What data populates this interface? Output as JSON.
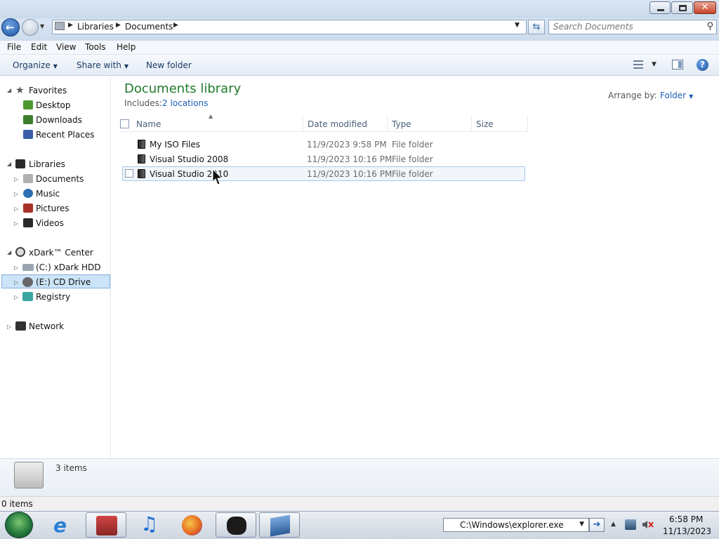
{
  "window": {
    "close_glyph": "✕"
  },
  "address": {
    "crumbs": [
      "Libraries",
      "Documents"
    ],
    "search_placeholder": "Search Documents"
  },
  "menu": [
    "File",
    "Edit",
    "View",
    "Tools",
    "Help"
  ],
  "commands": {
    "organize": "Organize",
    "share_with": "Share with",
    "new_folder": "New folder"
  },
  "nav": {
    "favorites": {
      "label": "Favorites",
      "items": [
        "Desktop",
        "Downloads",
        "Recent Places"
      ]
    },
    "libraries": {
      "label": "Libraries",
      "items": [
        "Documents",
        "Music",
        "Pictures",
        "Videos"
      ]
    },
    "computer": {
      "label": "xDark™ Center",
      "items": [
        "(C:) xDark HDD",
        "(E:) CD Drive",
        "Registry"
      ]
    },
    "network": {
      "label": "Network"
    }
  },
  "library": {
    "title": "Documents library",
    "includes_label": "Includes:",
    "includes_link": "2 locations",
    "arrange_label": "Arrange by:",
    "arrange_value": "Folder"
  },
  "columns": [
    "Name",
    "Date modified",
    "Type",
    "Size"
  ],
  "files": [
    {
      "name": "My ISO Files",
      "date": "11/9/2023 9:58 PM",
      "type": "File folder",
      "size": ""
    },
    {
      "name": "Visual Studio 2008",
      "date": "11/9/2023 10:16 PM",
      "type": "File folder",
      "size": ""
    },
    {
      "name": "Visual Studio 2010",
      "date": "11/9/2023 10:16 PM",
      "type": "File folder",
      "size": ""
    }
  ],
  "details": {
    "count": "3 items"
  },
  "status": {
    "text": "0 items"
  },
  "taskbar": {
    "run_value": "C:\\Windows\\explorer.exe",
    "clock_time": "6:58 PM",
    "clock_date": "11/13/2023"
  }
}
